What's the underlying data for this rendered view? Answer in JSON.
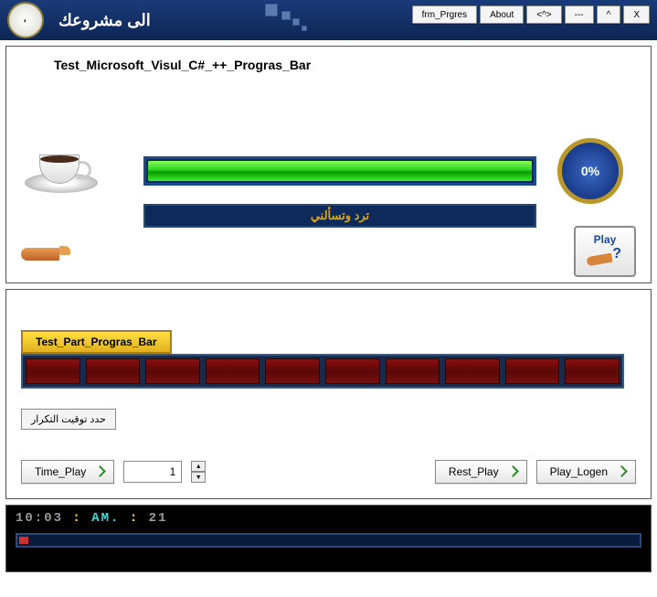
{
  "title": "الى مشروعك",
  "titleButtons": {
    "frm": "frm_Prgres",
    "about": "About",
    "caret": "<^>",
    "min": "---",
    "max": "^",
    "close": "X"
  },
  "top": {
    "heading": "Test_Microsoft_Visul_C#_++_Progras_Bar",
    "navyText": "ترد وتسألني",
    "percent": "0%",
    "playLabel": "Play"
  },
  "mid": {
    "tabLabel": "Test_Part_Progras_Bar",
    "groupLabel": "حدد توقيت التكرار",
    "timePlay": "Time_Play",
    "numValue": "1",
    "restPlay": "Rest_Play",
    "playLogen": "Play_Logen"
  },
  "clock": {
    "h": "10:03",
    "ampm": "AM.",
    "extra": "21"
  }
}
